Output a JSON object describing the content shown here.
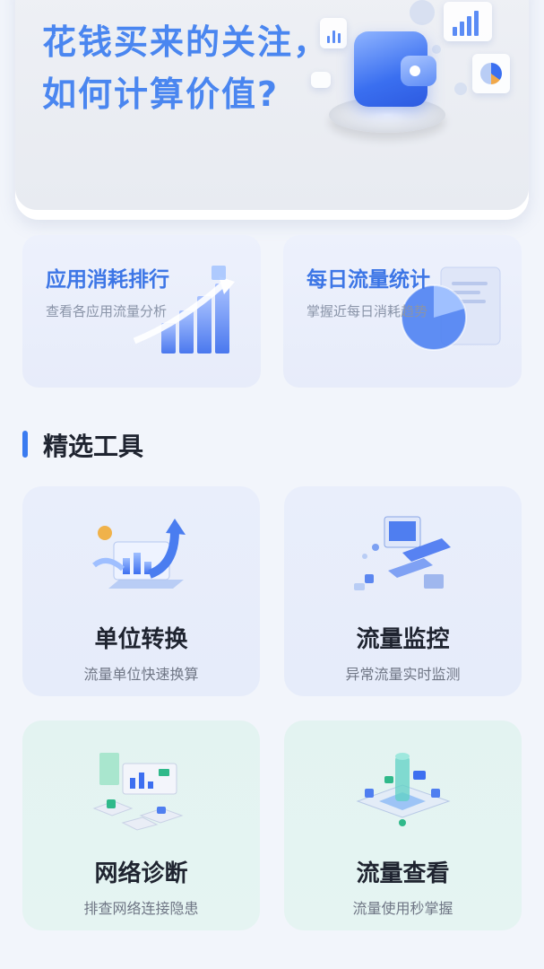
{
  "banner": {
    "title_line1": "花钱买来的关注，",
    "title_line2": "如何计算价值?"
  },
  "features": [
    {
      "title": "应用消耗排行",
      "subtitle": "查看各应用流量分析"
    },
    {
      "title": "每日流量统计",
      "subtitle": "掌握近每日消耗趋势"
    }
  ],
  "section": {
    "title": "精选工具"
  },
  "tools": [
    {
      "title": "单位转换",
      "subtitle": "流量单位快速换算"
    },
    {
      "title": "流量监控",
      "subtitle": "异常流量实时监测"
    },
    {
      "title": "网络诊断",
      "subtitle": "排查网络连接隐患"
    },
    {
      "title": "流量查看",
      "subtitle": "流量使用秒掌握"
    }
  ],
  "colors": {
    "accent": "#3a7bf0",
    "banner_text": "#4a86f0",
    "tool_blue_bg": "#e9eefb",
    "tool_green_bg": "#e3f3f1"
  }
}
